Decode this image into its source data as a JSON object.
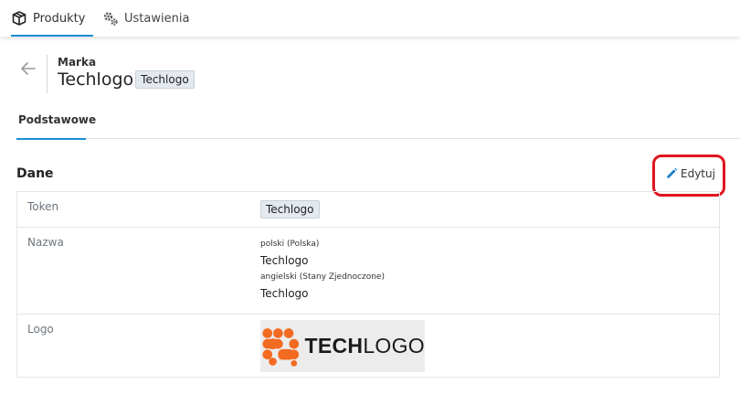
{
  "nav": {
    "tabs": [
      {
        "label": "Produkty",
        "icon": "box-icon",
        "active": true
      },
      {
        "label": "Ustawienia",
        "icon": "gears-icon",
        "active": false
      }
    ],
    "accent_color": "#1b8fd2"
  },
  "header": {
    "label": "Marka",
    "title": "Techlogo",
    "badge": "Techlogo"
  },
  "subtabs": [
    {
      "label": "Podstawowe",
      "active": true
    }
  ],
  "section": {
    "title": "Dane",
    "edit_label": "Edytuj",
    "highlight_color": "#e0141e"
  },
  "table": {
    "token": {
      "label": "Token",
      "value": "Techlogo"
    },
    "nazwa": {
      "label": "Nazwa",
      "entries": [
        {
          "locale": "polski (Polska)",
          "value": "Techlogo"
        },
        {
          "locale": "angielski (Stany Zjednoczone)",
          "value": "Techlogo"
        }
      ]
    },
    "logo": {
      "label": "Logo",
      "brand_part1": "TECH",
      "brand_part2": "LOGO",
      "brand_color": "#f36b21"
    }
  }
}
